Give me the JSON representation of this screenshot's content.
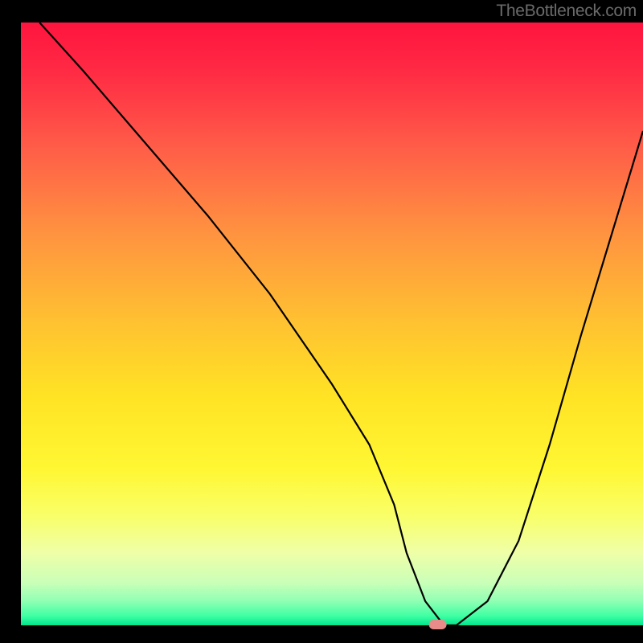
{
  "watermark": "TheBottleneck.com",
  "chart_data": {
    "type": "line",
    "title": "",
    "xlabel": "",
    "ylabel": "",
    "ylim": [
      0,
      100
    ],
    "xlim": [
      0,
      100
    ],
    "x": [
      3,
      10,
      20,
      30,
      40,
      50,
      56,
      60,
      62,
      65,
      68,
      70,
      75,
      80,
      85,
      90,
      95,
      100
    ],
    "values": [
      100,
      92,
      80,
      68,
      55,
      40,
      30,
      20,
      12,
      4,
      0,
      0,
      4,
      14,
      30,
      48,
      65,
      82
    ],
    "optimum_x": 67,
    "annotations": [
      {
        "type": "marker",
        "x": 67,
        "y": 0,
        "color": "#e98b89"
      }
    ],
    "background": "red-yellow-green vertical gradient",
    "axis_color": "#000000",
    "curve_color": "#000000"
  }
}
